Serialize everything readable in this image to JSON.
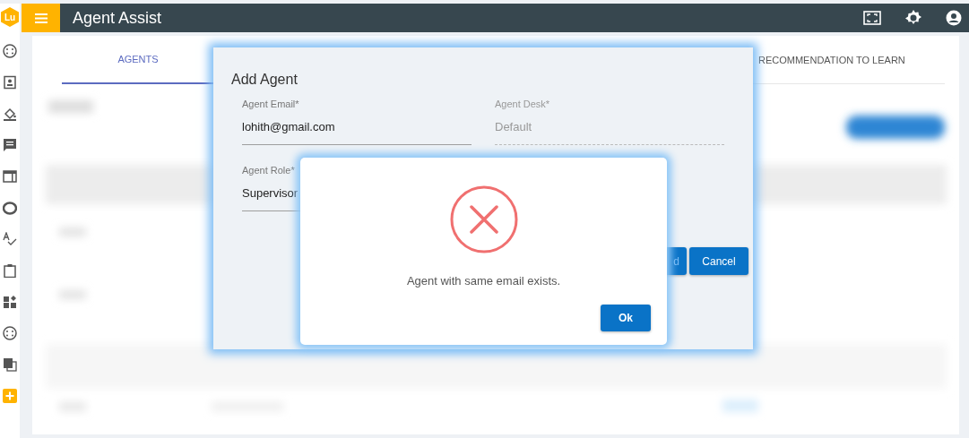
{
  "app": {
    "logo": "Lu",
    "title": "Agent Assist"
  },
  "tabs": [
    {
      "label": "AGENTS",
      "selected": true
    },
    {
      "label": "RECOMMENDATION TO LEARN",
      "selected": false
    }
  ],
  "add_agent_dialog": {
    "title": "Add Agent",
    "fields": [
      {
        "label": "Agent Email*",
        "value": "lohith@gmail.com",
        "disabled": false
      },
      {
        "label": "Agent Desk*",
        "value": "Default",
        "disabled": true
      },
      {
        "label": "Agent Role*",
        "value": "Supervisor",
        "disabled": false
      }
    ],
    "buttons": [
      "d",
      "Cancel"
    ]
  },
  "alert": {
    "kind": "error",
    "message": "Agent with same email exists.",
    "button": "Ok"
  }
}
